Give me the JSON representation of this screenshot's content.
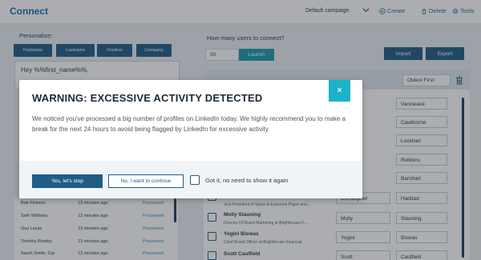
{
  "header": {
    "title": "Connect",
    "campaign": "Default campaign",
    "create_label": "Create",
    "delete_label": "Delete",
    "tools_label": "Tools"
  },
  "left": {
    "personalize_label": "Personalize:",
    "chips": [
      "Firstname",
      "Lastname",
      "Position",
      "Company"
    ],
    "message": "Hey %%first_name%%,",
    "activity": [
      {
        "name": "Bob Flowers",
        "time": "13 minutes ago",
        "status": "Processed"
      },
      {
        "name": "Seth Williams",
        "time": "13 minutes ago",
        "status": "Processed"
      },
      {
        "name": "Guy Lucas",
        "time": "13 minutes ago",
        "status": "Processed"
      },
      {
        "name": "Timothy Rowley",
        "time": "13 minutes ago",
        "status": "Processed"
      },
      {
        "name": "Sarah Smith, Crp",
        "time": "13 minutes ago",
        "status": "Processed"
      }
    ]
  },
  "right": {
    "how_many_label": "How many users to connect?",
    "count_value": "50",
    "launch_label": "Launch",
    "import_label": "Import",
    "export_label": "Export",
    "sort_value": "Oldest First",
    "partial_lastnames": [
      "Vancleave",
      "Cawthorne",
      "Lockhart",
      "Robbins",
      "Barnhart"
    ],
    "partial_firstname": "Christopher",
    "partial_row_lastname": "Haddad",
    "partial_row_sub": "Vice President of Sales at Evanston Paper and...",
    "rows": [
      {
        "name": "Molly Stauning",
        "sub": "Director Of Brand Marketing at Brighthouse F...",
        "first": "Molly",
        "last": "Stauning"
      },
      {
        "name": "Yogini Biswas",
        "sub": "Chief Brand Officer at Brighthouse Financial",
        "first": "Yogini",
        "last": "Biswas"
      },
      {
        "name": "Scott Caulfield",
        "sub": "",
        "first": "Scott",
        "last": "Caulfield"
      }
    ]
  },
  "modal": {
    "title": "WARNING: EXCESSIVE ACTIVITY DETECTED",
    "body": "We noticed you've processed a big number of profiles on LinkedIn today. We highly recommend you to make a break for the next 24 hours to avoid being flagged by LinkedIn for excessive activity",
    "stop_label": "Yes, let's stop",
    "continue_label": "No, I want to continue",
    "dont_show_label": "Got it, no need to show it again",
    "close_glyph": "×"
  },
  "colors": {
    "primary": "#1f5d86",
    "accent_teal": "#1bb3c9",
    "processed": "#2a8fb8"
  }
}
